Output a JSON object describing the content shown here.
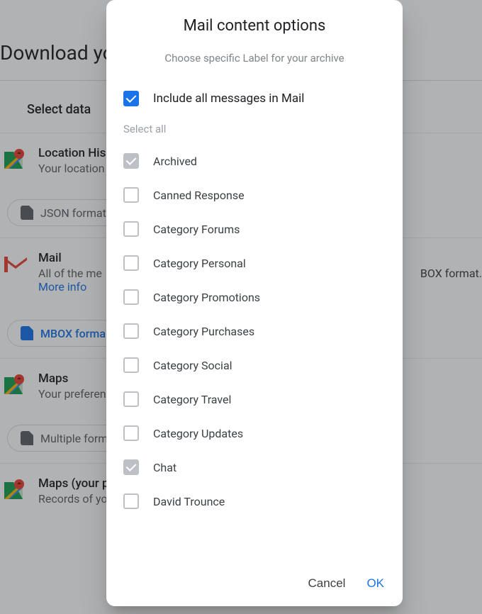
{
  "bg": {
    "heading": "Download yo",
    "section_label": "Select data ",
    "location": {
      "title": "Location His",
      "subtitle": "Your location",
      "chip": "JSON format"
    },
    "mail": {
      "title": "Mail",
      "subtitle": "All of the me",
      "format_suffix": "BOX format.",
      "more_info": "More info",
      "chip": "MBOX forma"
    },
    "maps": {
      "title": "Maps",
      "subtitle": "Your preferen",
      "chip": "Multiple form"
    },
    "maps_places": {
      "title": "Maps (your p",
      "subtitle": "Records of yo"
    }
  },
  "dialog": {
    "title": "Mail content options",
    "subtitle": "Choose specific Label for your archive",
    "include_all": "Include all messages in Mail",
    "select_all": "Select all",
    "labels": [
      {
        "name": "Archived",
        "checked": "grey"
      },
      {
        "name": "Canned Response",
        "checked": "none"
      },
      {
        "name": "Category Forums",
        "checked": "none"
      },
      {
        "name": "Category Personal",
        "checked": "none"
      },
      {
        "name": "Category Promotions",
        "checked": "none"
      },
      {
        "name": "Category Purchases",
        "checked": "none"
      },
      {
        "name": "Category Social",
        "checked": "none"
      },
      {
        "name": "Category Travel",
        "checked": "none"
      },
      {
        "name": "Category Updates",
        "checked": "none"
      },
      {
        "name": "Chat",
        "checked": "grey"
      },
      {
        "name": "David Trounce",
        "checked": "none"
      }
    ],
    "cancel": "Cancel",
    "ok": "OK"
  }
}
